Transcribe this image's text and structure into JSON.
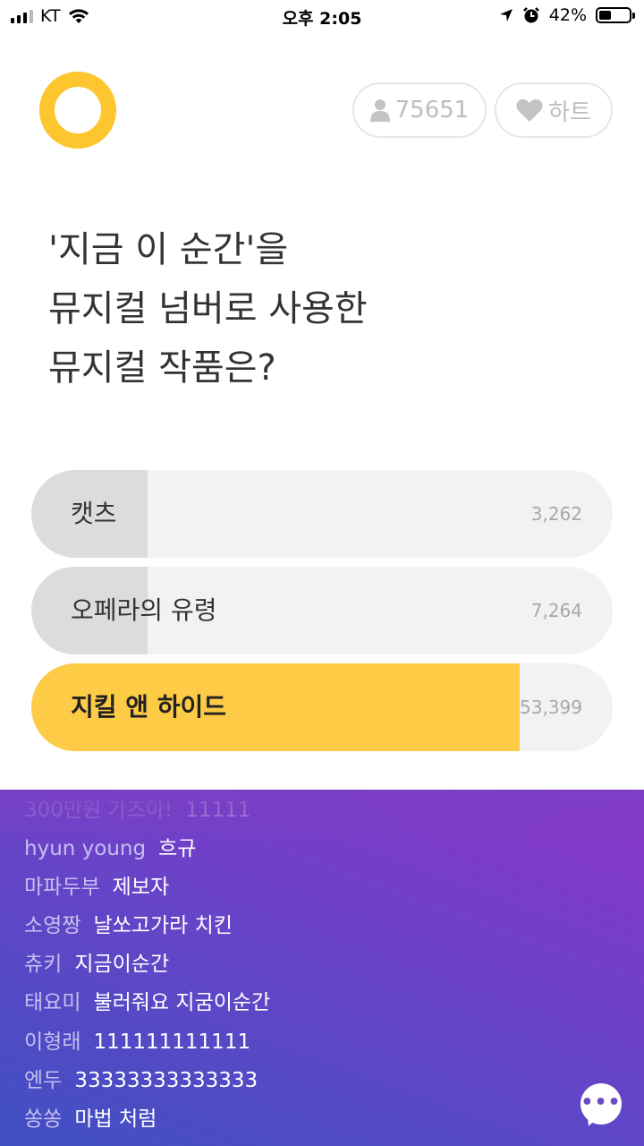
{
  "status_bar": {
    "carrier": "KT",
    "time": "오후 2:05",
    "battery": "42%",
    "battery_level": 0.42
  },
  "header": {
    "participants": "75651",
    "heart_label": "하트"
  },
  "question": {
    "lines": [
      "'지금 이 순간'을",
      "뮤지컬 넘버로 사용한",
      "뮤지컬 작품은?"
    ]
  },
  "options": [
    {
      "label": "캣츠",
      "count": "3,262",
      "share": 0.05,
      "selected": false
    },
    {
      "label": "오페라의 유령",
      "count": "7,264",
      "share": 0.11,
      "selected": false
    },
    {
      "label": "지킬 앤 하이드",
      "count": "53,399",
      "share": 0.84,
      "selected": true
    }
  ],
  "colors": {
    "accent": "#fdc52e",
    "chat_gradient_top": "#8a36c9",
    "chat_gradient_bottom": "#3f50c3"
  },
  "chat": {
    "messages": [
      {
        "name": "300만원 가즈아!",
        "text": "11111"
      },
      {
        "name": "hyun young",
        "text": "흐규"
      },
      {
        "name": "마파두부",
        "text": "제보자"
      },
      {
        "name": "소영짱",
        "text": "날쏘고가라 치킨"
      },
      {
        "name": "츄키",
        "text": "지금이순간"
      },
      {
        "name": "태요미",
        "text": "불러줘요 지굼이순간"
      },
      {
        "name": "이형래",
        "text": "111111111111"
      },
      {
        "name": "엔두",
        "text": "33333333333333"
      },
      {
        "name": "쏭쏭",
        "text": "마법 처럼"
      }
    ],
    "button_icon": "chat-bubble-icon"
  }
}
